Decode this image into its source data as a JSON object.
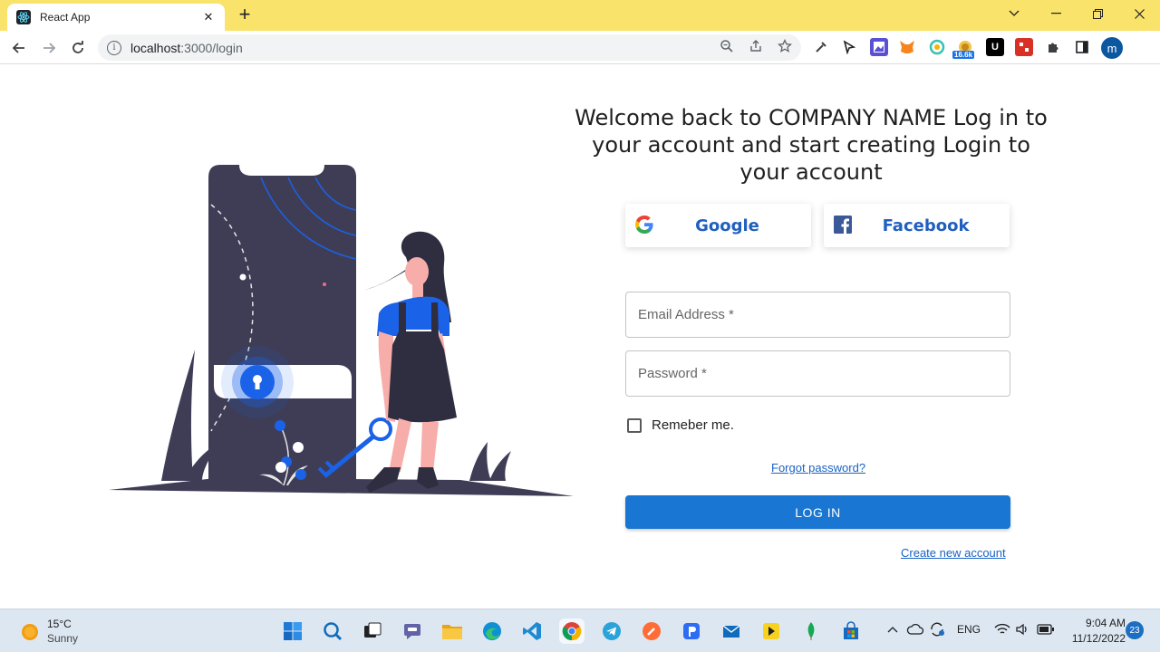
{
  "browser": {
    "tab_title": "React App",
    "tab_close": "✕",
    "new_tab": "+",
    "url_host": "localhost",
    "url_path": ":3000/login",
    "ext_badge": "16.6k",
    "profile_initial": "m"
  },
  "login": {
    "heading": "Welcome back to COMPANY NAME Log in to your account and start creating Login to your account",
    "google_label": "Google",
    "facebook_label": "Facebook",
    "email_placeholder": "Email Address *",
    "password_placeholder": "Password *",
    "remember_label": "Remeber me.",
    "forgot_link": "Forgot password?",
    "login_button": "LOG IN",
    "create_link": "Create new account"
  },
  "taskbar": {
    "weather_temp": "15°C",
    "weather_desc": "Sunny",
    "language": "ENG",
    "time": "9:04 AM",
    "date": "11/12/2022",
    "notification_count": "23"
  },
  "colors": {
    "tabbar_bg": "#fae36a",
    "primary": "#1976d2",
    "link": "#1a63c4",
    "illustration_dark": "#3f3d56",
    "illustration_blue": "#1a62e8",
    "skin": "#f7aeaa"
  }
}
